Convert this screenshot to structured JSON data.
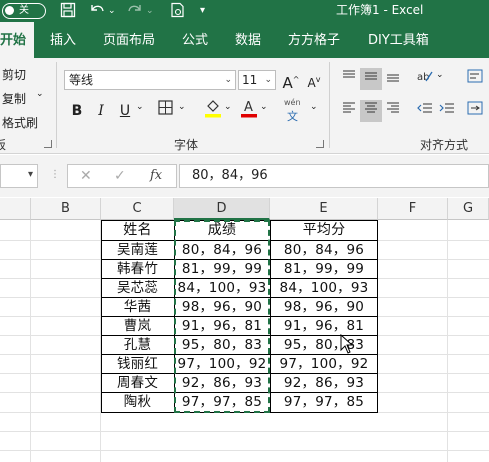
{
  "titlebar": {
    "autosave_label": "关",
    "title": "工作簿1 - Excel",
    "bg": "#217346",
    "quick_access_icons": [
      "save-icon",
      "undo-icon",
      "redo-icon",
      "touch-mode-icon",
      "customize-icon"
    ]
  },
  "tabs": [
    "开始",
    "插入",
    "页面布局",
    "公式",
    "数据",
    "方方格子",
    "DIY工具箱"
  ],
  "ribbon": {
    "clipboard": {
      "cut": "剪切",
      "copy": "复制",
      "format_painter": "格式刷",
      "group_label_partial": "板"
    },
    "font": {
      "font_name": "等线",
      "font_size": "11",
      "group_label": "字体",
      "bold": "B",
      "italic": "I",
      "underline": "U",
      "phonetic_top": "wén",
      "phonetic_bottom": "文"
    },
    "alignment": {
      "group_label": "对齐方式"
    }
  },
  "formula_bar": {
    "value": "80，84，96",
    "fx": "fx"
  },
  "columns": [
    "B",
    "C",
    "D",
    "E",
    "F",
    "G"
  ],
  "table": {
    "headers": [
      "姓名",
      "成绩",
      "平均分"
    ],
    "rows": [
      [
        "吴南莲",
        "80，84，96",
        "80，84，96"
      ],
      [
        "韩春竹",
        "81，99，99",
        "81，99，99"
      ],
      [
        "吴芯蕊",
        "84，100，93",
        "84，100，93"
      ],
      [
        "华茜",
        "98，96，90",
        "98，96，90"
      ],
      [
        "曹岚",
        "91，96，81",
        "91，96，81"
      ],
      [
        "孔慧",
        "95，80，83",
        "95，80，83"
      ],
      [
        "钱丽红",
        "97，100，92",
        "97，100，92"
      ],
      [
        "周春文",
        "92，86，93",
        "92，86，93"
      ],
      [
        "陶秋",
        "97，97，85",
        "97，97，85"
      ]
    ]
  },
  "colors": {
    "accent": "#217346",
    "ribbon_bg": "#f3f3f3",
    "underline_red": "#e00000",
    "highlight_yellow": "#ffff00"
  }
}
